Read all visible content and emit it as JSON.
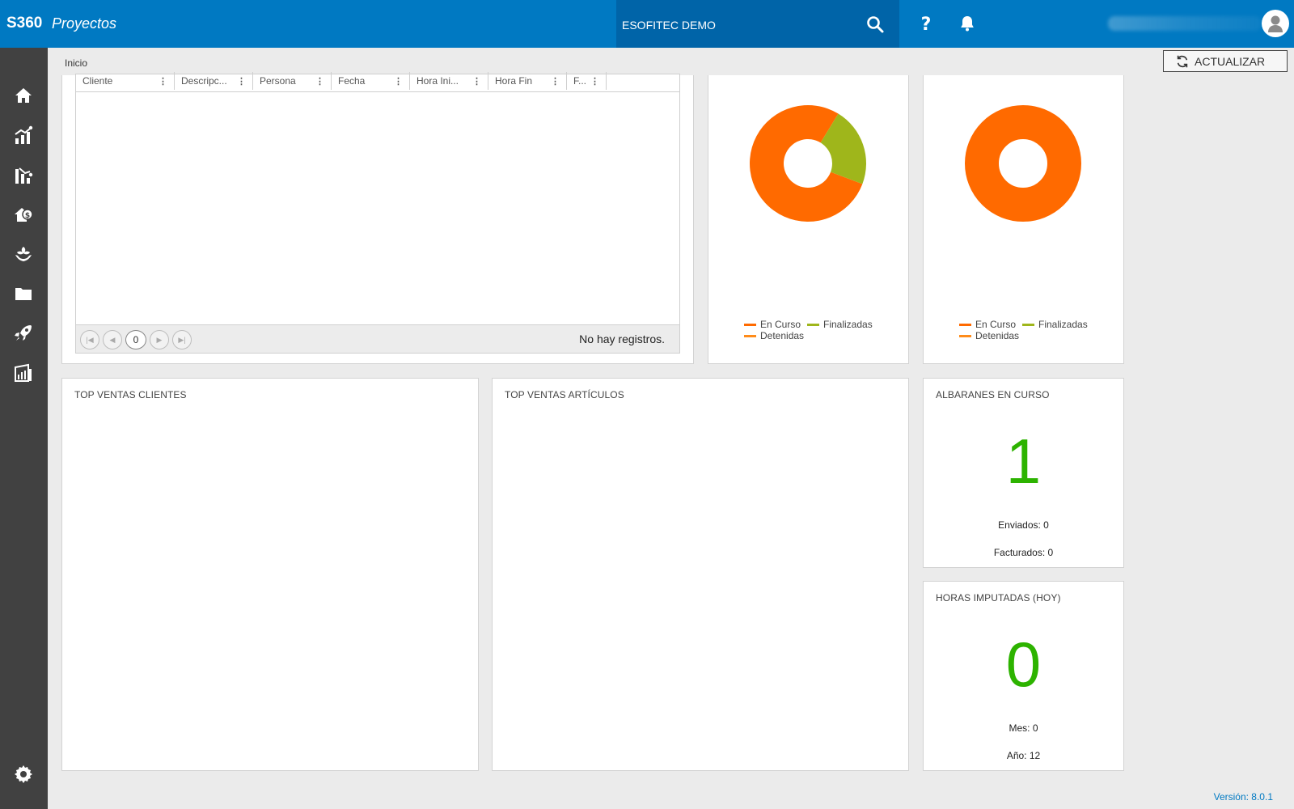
{
  "header": {
    "brand": "S360",
    "app_name": "Proyectos",
    "company": "ESOFITEC DEMO",
    "icons": [
      "search-icon",
      "help-icon",
      "bell-icon",
      "avatar-icon"
    ]
  },
  "sidebar": {
    "items": [
      {
        "name": "home-icon"
      },
      {
        "name": "sales-chart-icon"
      },
      {
        "name": "purchases-chart-icon"
      },
      {
        "name": "finance-house-icon"
      },
      {
        "name": "plant-hands-icon"
      },
      {
        "name": "folder-icon"
      },
      {
        "name": "rocket-icon"
      },
      {
        "name": "reports-icon"
      }
    ],
    "settings_icon": "gear-icon"
  },
  "breadcrumb": {
    "label": "Inicio"
  },
  "refresh_button": {
    "label": "ACTUALIZAR"
  },
  "grid": {
    "columns": [
      "Cliente",
      "Descripc...",
      "Persona",
      "Fecha",
      "Hora Ini...",
      "Hora Fin",
      "F..."
    ],
    "page_number": "0",
    "empty_text": "No hay registros."
  },
  "donut_1": {
    "legend": [
      "En Curso",
      "Finalizadas",
      "Detenidas"
    ]
  },
  "donut_2": {
    "legend": [
      "En Curso",
      "Finalizadas",
      "Detenidas"
    ]
  },
  "chart_data": [
    {
      "type": "pie",
      "donut": true,
      "labels": [
        "En Curso",
        "Finalizadas",
        "Detenidas"
      ],
      "colors": [
        "#ff6a00",
        "#9fb61b",
        "#ff8c1a"
      ],
      "values": [
        78,
        22,
        0
      ]
    },
    {
      "type": "pie",
      "donut": true,
      "labels": [
        "En Curso",
        "Finalizadas",
        "Detenidas"
      ],
      "colors": [
        "#ff6a00",
        "#9fb61b",
        "#ff8c1a"
      ],
      "values": [
        100,
        0,
        0
      ]
    }
  ],
  "panels": {
    "top_clients_title": "TOP VENTAS CLIENTES",
    "top_articles_title": "TOP VENTAS ARTÍCULOS",
    "albaranes": {
      "title": "ALBARANES EN CURSO",
      "value": "1",
      "line1": "Enviados: 0",
      "line2": "Facturados: 0"
    },
    "horas": {
      "title": "HORAS IMPUTADAS (HOY)",
      "value": "0",
      "line1": "Mes: 0",
      "line2": "Año: 12"
    }
  },
  "footer": {
    "version": "Versión: 8.0.1"
  },
  "colors": {
    "primary": "#0079c2",
    "sidebar": "#414141",
    "kpi_green": "#2db300",
    "orange": "#ff6a00",
    "olive": "#9fb61b"
  }
}
